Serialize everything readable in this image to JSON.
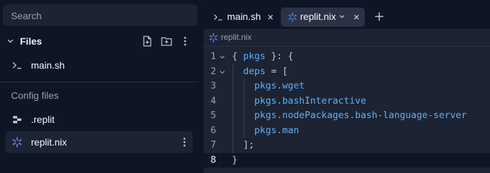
{
  "sidebar": {
    "search": {
      "placeholder": "Search"
    },
    "files": {
      "title": "Files",
      "items": [
        {
          "name": "main.sh",
          "icon": "terminal-icon"
        }
      ]
    },
    "config": {
      "title": "Config files",
      "items": [
        {
          "name": ".replit",
          "icon": "replit-config-icon"
        },
        {
          "name": "replit.nix",
          "icon": "nix-snowflake-icon",
          "selected": true
        }
      ]
    }
  },
  "editor": {
    "tabs": [
      {
        "label": "main.sh",
        "icon": "terminal-icon",
        "active": false
      },
      {
        "label": "replit.nix",
        "icon": "nix-snowflake-icon",
        "active": true
      }
    ],
    "breadcrumb": "replit.nix",
    "current_line": 8,
    "lines": [
      {
        "n": "1",
        "indent": 0,
        "tokens": [
          [
            "punct",
            "{ "
          ],
          [
            "id",
            "pkgs"
          ],
          [
            "punct",
            " }: {"
          ]
        ]
      },
      {
        "n": "2",
        "indent": 1,
        "tokens": [
          [
            "id",
            "deps"
          ],
          [
            "punct",
            " = ["
          ]
        ]
      },
      {
        "n": "3",
        "indent": 2,
        "tokens": [
          [
            "id",
            "pkgs.wget"
          ]
        ]
      },
      {
        "n": "4",
        "indent": 2,
        "tokens": [
          [
            "id",
            "pkgs.bashInteractive"
          ]
        ]
      },
      {
        "n": "5",
        "indent": 2,
        "tokens": [
          [
            "id",
            "pkgs.nodePackages.bash-language-server"
          ]
        ]
      },
      {
        "n": "6",
        "indent": 2,
        "tokens": [
          [
            "id",
            "pkgs.man"
          ]
        ]
      },
      {
        "n": "7",
        "indent": 1,
        "tokens": [
          [
            "punct",
            "];"
          ]
        ]
      },
      {
        "n": "8",
        "indent": 0,
        "tokens": [
          [
            "punct",
            "}"
          ]
        ]
      }
    ]
  },
  "colors": {
    "bg": "#0e1525",
    "panel": "#1c2333",
    "active": "#2b3245",
    "identifier": "#5fb2f4",
    "nix": "#5277c3"
  }
}
